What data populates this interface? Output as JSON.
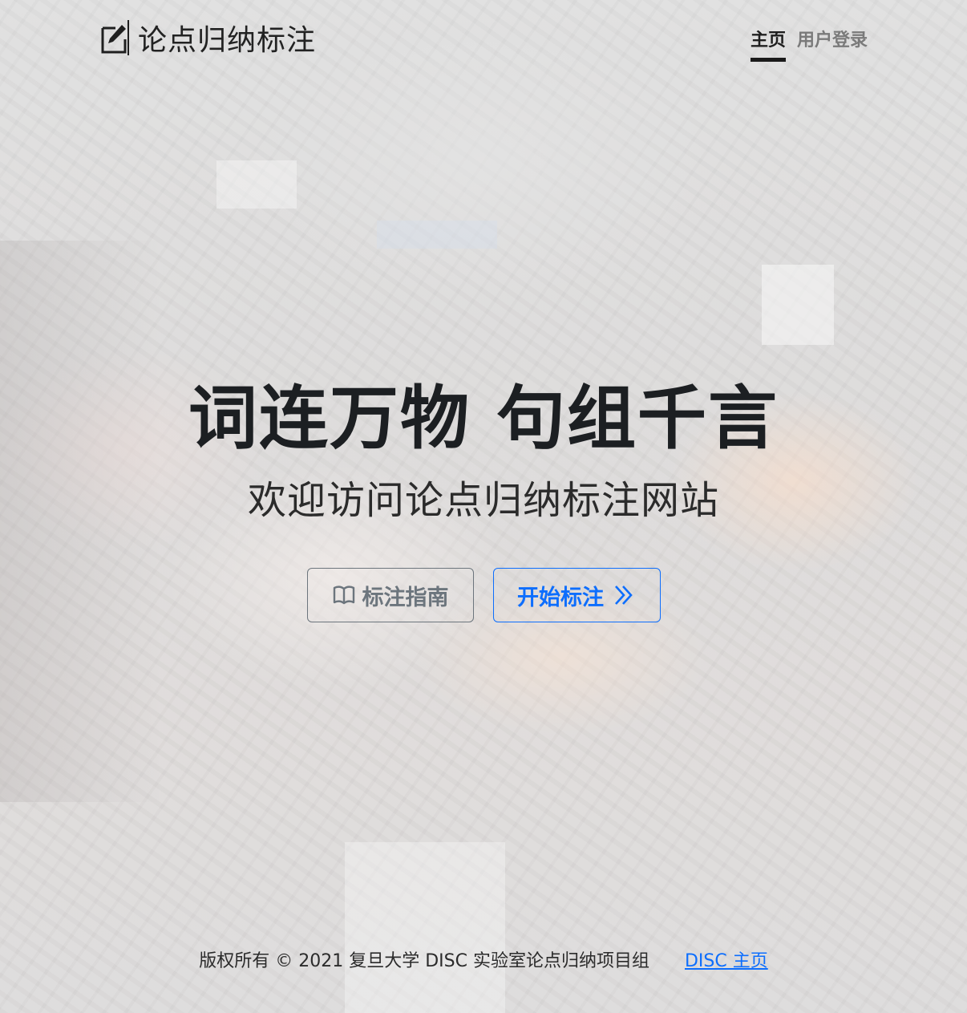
{
  "header": {
    "brand_icon": "pencil-square-icon",
    "brand_name": "论点归纳标注",
    "nav": [
      {
        "label": "主页",
        "active": true
      },
      {
        "label": "用户登录",
        "active": false
      }
    ]
  },
  "hero": {
    "title": "词连万物 句组千言",
    "subtitle": "欢迎访问论点归纳标注网站",
    "buttons": {
      "guide": {
        "label": "标注指南",
        "icon": "book-icon"
      },
      "start": {
        "label": "开始标注",
        "icon": "chevron-double-right-icon"
      }
    }
  },
  "footer": {
    "copyright": "版权所有 © 2021 复旦大学 DISC 实验室论点归纳项目组",
    "link_label": "DISC 主页"
  },
  "colors": {
    "primary": "#0d6efd",
    "secondary": "#6c757d",
    "text_dark": "#212529"
  }
}
